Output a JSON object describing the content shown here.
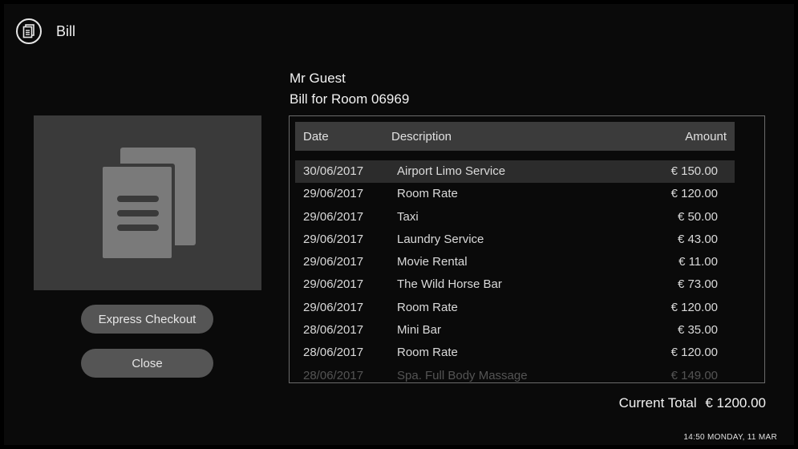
{
  "header": {
    "title": "Bill",
    "icon": "document-icon"
  },
  "guest": {
    "name": "Mr Guest",
    "bill_for": "Bill for Room 06969"
  },
  "buttons": {
    "express_checkout": "Express Checkout",
    "close": "Close"
  },
  "table": {
    "columns": {
      "date": "Date",
      "description": "Description",
      "amount": "Amount"
    },
    "rows": [
      {
        "date": "30/06/2017",
        "description": "Airport Limo Service",
        "amount": "€ 150.00"
      },
      {
        "date": "29/06/2017",
        "description": "Room Rate",
        "amount": "€ 120.00"
      },
      {
        "date": "29/06/2017",
        "description": "Taxi",
        "amount": "€ 50.00"
      },
      {
        "date": "29/06/2017",
        "description": "Laundry Service",
        "amount": "€ 43.00"
      },
      {
        "date": "29/06/2017",
        "description": "Movie Rental",
        "amount": "€ 11.00"
      },
      {
        "date": "29/06/2017",
        "description": "The Wild Horse Bar",
        "amount": "€ 73.00"
      },
      {
        "date": "29/06/2017",
        "description": "Room Rate",
        "amount": "€ 120.00"
      },
      {
        "date": "28/06/2017",
        "description": "Mini Bar",
        "amount": "€ 35.00"
      },
      {
        "date": "28/06/2017",
        "description": "Room Rate",
        "amount": "€ 120.00"
      },
      {
        "date": "28/06/2017",
        "description": "Spa. Full Body Massage",
        "amount": "€ 149.00"
      }
    ]
  },
  "total": {
    "label": "Current Total",
    "value": "€ 1200.00"
  },
  "clock": "14:50 MONDAY, 11 MAR",
  "colors": {
    "background": "#0a0a0a",
    "panel": "#3a3a3a",
    "button": "#555555"
  }
}
